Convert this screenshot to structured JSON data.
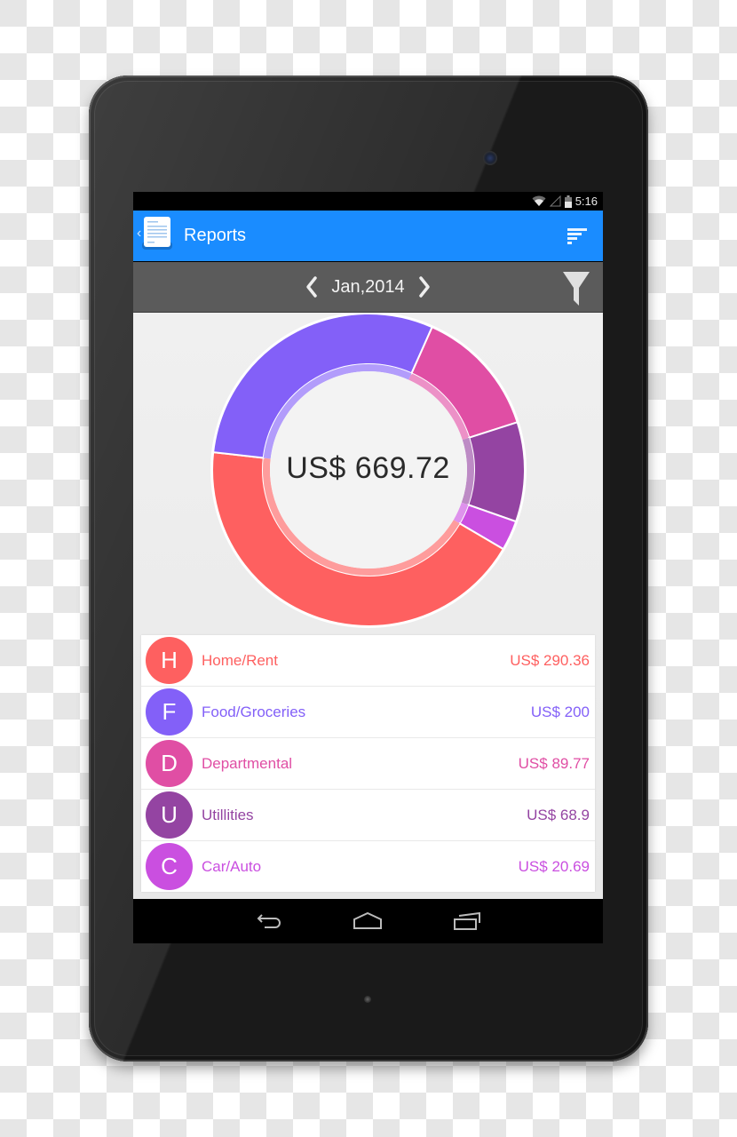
{
  "status_bar": {
    "time": "5:16",
    "icons": [
      "wifi-icon",
      "signal-icon",
      "battery-icon"
    ]
  },
  "app_bar": {
    "title": "Reports",
    "app_icon": "report-document-icon",
    "up_icon": "chevron-left-icon",
    "action_icon": "sort-icon"
  },
  "date_bar": {
    "period": "Jan,2014",
    "prev_icon": "chevron-left-icon",
    "next_icon": "chevron-right-icon",
    "filter_icon": "filter-funnel-icon"
  },
  "summary": {
    "total": "US$ 669.72"
  },
  "categories": [
    {
      "initial": "H",
      "name": "Home/Rent",
      "amount": "US$ 290.36",
      "color": "#fe6060"
    },
    {
      "initial": "F",
      "name": "Food/Groceries",
      "amount": "US$ 200",
      "color": "#8360f8"
    },
    {
      "initial": "D",
      "name": "Departmental",
      "amount": "US$ 89.77",
      "color": "#e04ea4"
    },
    {
      "initial": "U",
      "name": "Utillities",
      "amount": "US$ 68.9",
      "color": "#9444a2"
    },
    {
      "initial": "C",
      "name": "Car/Auto",
      "amount": "US$ 20.69",
      "color": "#ca4fe0"
    }
  ],
  "chart_data": {
    "type": "pie",
    "variant": "donut",
    "title": "",
    "center_label": "US$ 669.72",
    "categories": [
      "Home/Rent",
      "Food/Groceries",
      "Departmental",
      "Utillities",
      "Car/Auto"
    ],
    "values": [
      290.36,
      200,
      89.77,
      68.9,
      20.69
    ],
    "colors": [
      "#fe6060",
      "#8360f8",
      "#e04ea4",
      "#9444a2",
      "#ca4fe0"
    ],
    "total": 669.72,
    "start_segment": "Departmental",
    "direction": "clockwise",
    "start_angle_deg": 24,
    "legend": "below"
  },
  "nav_bar": {
    "buttons": [
      "back-icon",
      "home-icon",
      "recent-apps-icon"
    ]
  }
}
